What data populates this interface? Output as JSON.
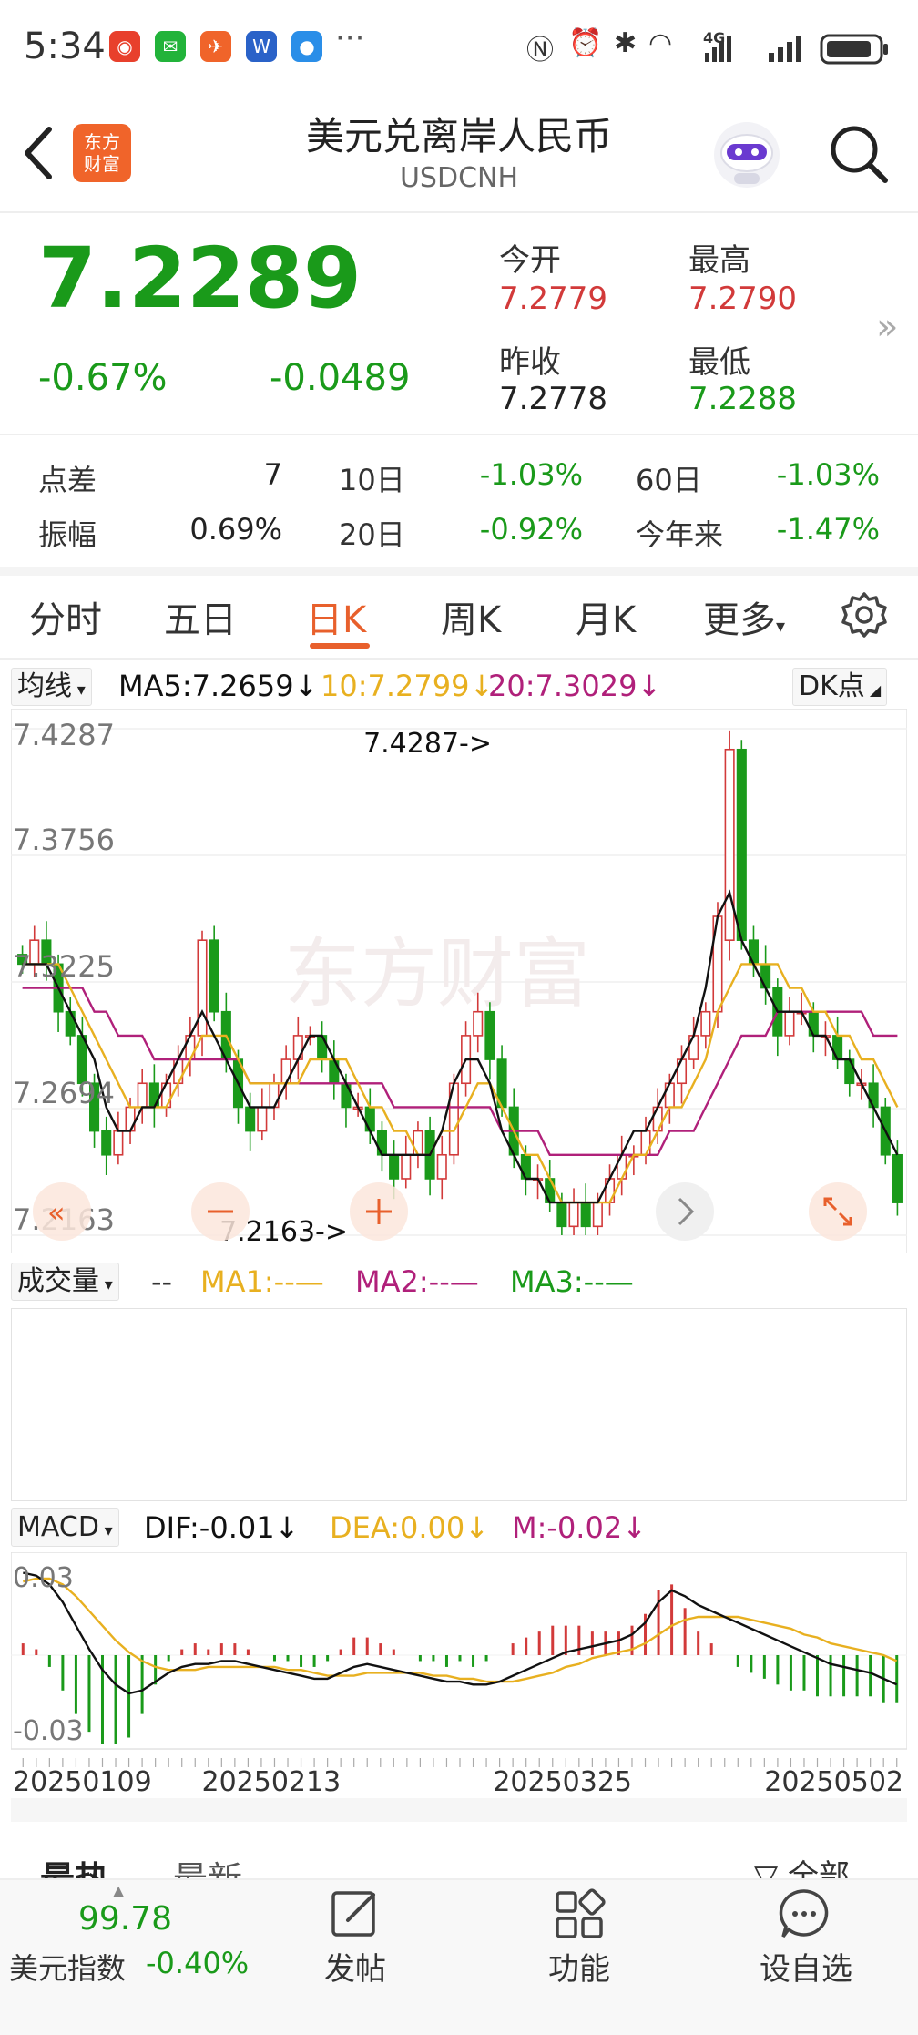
{
  "status_bar": {
    "time": "5:34",
    "more": "···",
    "icons": [
      "weibo-icon",
      "wechat-icon",
      "app-orange-icon",
      "app-blue-icon",
      "message-icon",
      "nfc-icon",
      "alarm-icon",
      "bluetooth-icon",
      "wifi-icon",
      "signal-4g-icon",
      "signal-icon",
      "battery-icon"
    ],
    "network": "4G"
  },
  "header": {
    "title": "美元兑离岸人民币",
    "subtitle": "USDCNH",
    "logo_line1": "东方",
    "logo_line2": "财富"
  },
  "quote": {
    "price": "7.2289",
    "change_pct": "-0.67%",
    "change": "-0.0489",
    "open_label": "今开",
    "open": "7.2779",
    "high_label": "最高",
    "high": "7.2790",
    "prev_close_label": "昨收",
    "prev_close": "7.2778",
    "low_label": "最低",
    "low": "7.2288"
  },
  "stats": {
    "spread_label": "点差",
    "spread": "7",
    "amplitude_label": "振幅",
    "amplitude": "0.69%",
    "d10_label": "10日",
    "d10": "-1.03%",
    "d20_label": "20日",
    "d20": "-0.92%",
    "d60_label": "60日",
    "d60": "-1.03%",
    "ytd_label": "今年来",
    "ytd": "-1.47%"
  },
  "tabs": {
    "fenshi": "分时",
    "wuri": "五日",
    "rik": "日K",
    "zhouk": "周K",
    "yuek": "月K",
    "more": "更多",
    "active": "日K"
  },
  "ma_bar": {
    "selector": "均线",
    "ma5": "MA5:7.2659",
    "ma10": "10:7.2799",
    "ma20": "20:7.3029",
    "dk": "DK点",
    "arrow": "↓"
  },
  "colors": {
    "up": "#d23a3a",
    "down": "#1a9a1a",
    "ma5": "#111111",
    "ma10": "#e8b020",
    "ma20": "#b0207a",
    "accent": "#e8602c"
  },
  "chart_data": [
    {
      "type": "candlestick",
      "price_axis_labels": [
        "7.4287",
        "7.3756",
        "7.3225",
        "7.2694",
        "7.2163"
      ],
      "ylim": [
        7.2163,
        7.4287
      ],
      "annotations": [
        {
          "text": "7.4287->",
          "value": 7.4287
        },
        {
          "text": "7.2163->",
          "value": 7.2163
        }
      ],
      "watermark": "东方财富",
      "candles_approx_close": [
        7.33,
        7.34,
        7.33,
        7.31,
        7.3,
        7.28,
        7.26,
        7.25,
        7.26,
        7.27,
        7.28,
        7.27,
        7.28,
        7.29,
        7.3,
        7.34,
        7.31,
        7.29,
        7.27,
        7.26,
        7.27,
        7.28,
        7.29,
        7.3,
        7.3,
        7.29,
        7.28,
        7.27,
        7.27,
        7.26,
        7.25,
        7.24,
        7.25,
        7.26,
        7.24,
        7.25,
        7.28,
        7.3,
        7.31,
        7.29,
        7.27,
        7.25,
        7.24,
        7.24,
        7.23,
        7.22,
        7.23,
        7.22,
        7.23,
        7.24,
        7.25,
        7.25,
        7.26,
        7.27,
        7.28,
        7.29,
        7.3,
        7.31,
        7.35,
        7.42,
        7.34,
        7.33,
        7.32,
        7.3,
        7.31,
        7.31,
        7.3,
        7.3,
        7.29,
        7.28,
        7.28,
        7.27,
        7.25,
        7.23
      ],
      "ma5": [
        7.33,
        7.33,
        7.33,
        7.32,
        7.31,
        7.3,
        7.29,
        7.27,
        7.26,
        7.26,
        7.27,
        7.27,
        7.28,
        7.29,
        7.3,
        7.31,
        7.3,
        7.29,
        7.28,
        7.27,
        7.27,
        7.27,
        7.28,
        7.29,
        7.3,
        7.3,
        7.29,
        7.28,
        7.27,
        7.26,
        7.25,
        7.25,
        7.25,
        7.25,
        7.25,
        7.26,
        7.28,
        7.29,
        7.29,
        7.28,
        7.26,
        7.25,
        7.24,
        7.24,
        7.23,
        7.23,
        7.23,
        7.23,
        7.23,
        7.24,
        7.25,
        7.26,
        7.26,
        7.27,
        7.28,
        7.29,
        7.3,
        7.32,
        7.35,
        7.36,
        7.34,
        7.33,
        7.32,
        7.31,
        7.31,
        7.31,
        7.3,
        7.3,
        7.29,
        7.29,
        7.28,
        7.27,
        7.26,
        7.25
      ],
      "ma10": [
        7.33,
        7.33,
        7.33,
        7.33,
        7.32,
        7.31,
        7.3,
        7.29,
        7.28,
        7.27,
        7.27,
        7.27,
        7.27,
        7.28,
        7.29,
        7.3,
        7.3,
        7.3,
        7.29,
        7.28,
        7.28,
        7.28,
        7.28,
        7.28,
        7.29,
        7.29,
        7.29,
        7.29,
        7.28,
        7.27,
        7.27,
        7.26,
        7.26,
        7.25,
        7.25,
        7.26,
        7.26,
        7.27,
        7.28,
        7.28,
        7.27,
        7.26,
        7.25,
        7.25,
        7.24,
        7.23,
        7.23,
        7.23,
        7.23,
        7.23,
        7.24,
        7.25,
        7.25,
        7.26,
        7.27,
        7.27,
        7.28,
        7.29,
        7.31,
        7.32,
        7.33,
        7.33,
        7.33,
        7.33,
        7.32,
        7.32,
        7.31,
        7.31,
        7.3,
        7.3,
        7.29,
        7.29,
        7.28,
        7.27
      ],
      "ma20": [
        7.32,
        7.32,
        7.32,
        7.32,
        7.32,
        7.32,
        7.31,
        7.31,
        7.3,
        7.3,
        7.3,
        7.29,
        7.29,
        7.29,
        7.29,
        7.29,
        7.29,
        7.29,
        7.29,
        7.28,
        7.28,
        7.28,
        7.28,
        7.28,
        7.28,
        7.28,
        7.28,
        7.28,
        7.28,
        7.28,
        7.28,
        7.27,
        7.27,
        7.27,
        7.27,
        7.27,
        7.27,
        7.27,
        7.27,
        7.27,
        7.26,
        7.26,
        7.26,
        7.26,
        7.25,
        7.25,
        7.25,
        7.25,
        7.25,
        7.25,
        7.25,
        7.25,
        7.25,
        7.25,
        7.26,
        7.26,
        7.26,
        7.27,
        7.28,
        7.29,
        7.3,
        7.3,
        7.3,
        7.31,
        7.31,
        7.31,
        7.31,
        7.31,
        7.31,
        7.31,
        7.31,
        7.3,
        7.3,
        7.3
      ]
    },
    {
      "type": "bar",
      "title": "成交量",
      "legend": [
        "MA1:--—",
        "MA2:--—",
        "MA3:--—"
      ],
      "values": []
    },
    {
      "type": "macd",
      "labels": {
        "selector": "MACD",
        "dif": "DIF:-0.01",
        "dea": "DEA:0.00",
        "m": "M:-0.02",
        "arrow": "↓"
      },
      "axis_labels": [
        "0.03",
        "-0.03"
      ],
      "ylim": [
        -0.03,
        0.03
      ],
      "x_labels": [
        "20250109",
        "20250213",
        "20250325",
        "20250502"
      ],
      "dif": [
        0.028,
        0.027,
        0.024,
        0.018,
        0.01,
        0.002,
        -0.005,
        -0.01,
        -0.013,
        -0.012,
        -0.009,
        -0.006,
        -0.004,
        -0.003,
        -0.003,
        -0.002,
        -0.002,
        -0.003,
        -0.004,
        -0.005,
        -0.006,
        -0.007,
        -0.008,
        -0.008,
        -0.006,
        -0.004,
        -0.003,
        -0.004,
        -0.005,
        -0.006,
        -0.007,
        -0.008,
        -0.009,
        -0.009,
        -0.01,
        -0.01,
        -0.009,
        -0.007,
        -0.005,
        -0.003,
        -0.001,
        0.001,
        0.002,
        0.003,
        0.004,
        0.005,
        0.007,
        0.011,
        0.018,
        0.022,
        0.02,
        0.017,
        0.015,
        0.013,
        0.011,
        0.009,
        0.007,
        0.005,
        0.003,
        0.001,
        -0.001,
        -0.003,
        -0.004,
        -0.005,
        -0.006,
        -0.008,
        -0.01
      ],
      "dea": [
        0.025,
        0.026,
        0.026,
        0.024,
        0.02,
        0.015,
        0.01,
        0.005,
        0.001,
        -0.002,
        -0.004,
        -0.005,
        -0.005,
        -0.005,
        -0.004,
        -0.004,
        -0.004,
        -0.004,
        -0.004,
        -0.004,
        -0.005,
        -0.005,
        -0.006,
        -0.007,
        -0.007,
        -0.007,
        -0.006,
        -0.006,
        -0.006,
        -0.006,
        -0.006,
        -0.007,
        -0.007,
        -0.008,
        -0.008,
        -0.009,
        -0.009,
        -0.009,
        -0.008,
        -0.007,
        -0.006,
        -0.004,
        -0.003,
        -0.001,
        0.0,
        0.001,
        0.002,
        0.004,
        0.007,
        0.01,
        0.012,
        0.013,
        0.013,
        0.013,
        0.013,
        0.012,
        0.011,
        0.01,
        0.009,
        0.007,
        0.006,
        0.004,
        0.003,
        0.002,
        0.001,
        0.0,
        -0.002
      ],
      "m": [
        0.004,
        0.002,
        -0.004,
        -0.012,
        -0.02,
        -0.026,
        -0.03,
        -0.03,
        -0.028,
        -0.02,
        -0.01,
        -0.002,
        0.002,
        0.004,
        0.002,
        0.004,
        0.004,
        0.002,
        0.0,
        -0.002,
        -0.002,
        -0.004,
        -0.004,
        -0.002,
        0.002,
        0.006,
        0.006,
        0.004,
        0.002,
        0.0,
        -0.002,
        -0.002,
        -0.004,
        -0.002,
        -0.004,
        -0.002,
        0.0,
        0.004,
        0.006,
        0.008,
        0.01,
        0.01,
        0.01,
        0.008,
        0.008,
        0.008,
        0.01,
        0.014,
        0.022,
        0.024,
        0.016,
        0.008,
        0.004,
        0.0,
        -0.004,
        -0.006,
        -0.008,
        -0.01,
        -0.012,
        -0.012,
        -0.014,
        -0.014,
        -0.014,
        -0.014,
        -0.014,
        -0.016,
        -0.016
      ]
    }
  ],
  "volume_bar": {
    "selector": "成交量",
    "dash": "--",
    "ma1": "MA1:--—",
    "ma2": "MA2:--—",
    "ma3": "MA3:--—"
  },
  "news_tabs": {
    "hot": "最热",
    "latest": "最新",
    "all": "全部"
  },
  "bottom_nav": {
    "index_value": "99.78",
    "index_name": "美元指数",
    "index_change": "-0.40%",
    "post": "发帖",
    "function": "功能",
    "watchlist": "设自选"
  }
}
